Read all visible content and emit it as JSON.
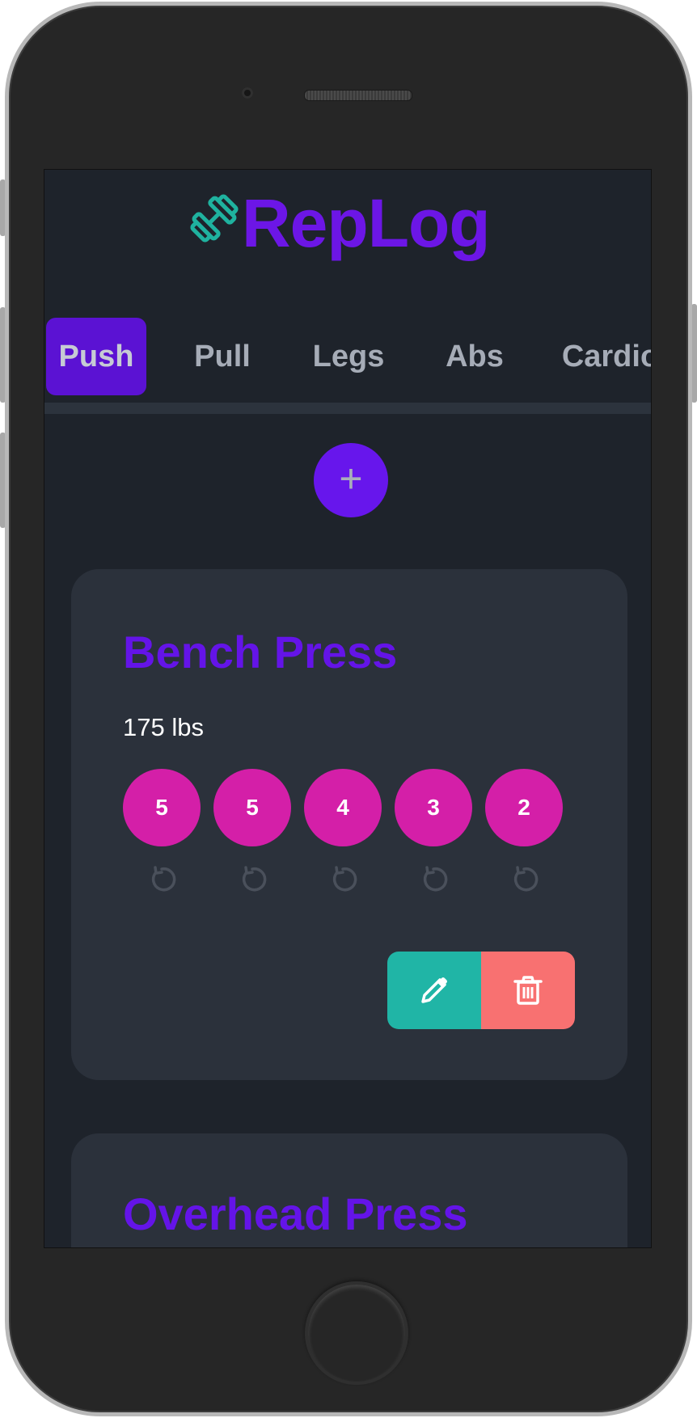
{
  "app": {
    "title": "RepLog",
    "logo_icon": "dumbbell-icon",
    "accent_color": "#6c16e6"
  },
  "tabs": [
    {
      "label": "Push",
      "active": true
    },
    {
      "label": "Pull",
      "active": false
    },
    {
      "label": "Legs",
      "active": false
    },
    {
      "label": "Abs",
      "active": false
    },
    {
      "label": "Cardio",
      "active": false
    }
  ],
  "add_button": {
    "label": "+"
  },
  "exercises": [
    {
      "name": "Bench Press",
      "weight": "175 lbs",
      "sets": [
        "5",
        "5",
        "4",
        "3",
        "2"
      ],
      "set_color": "#d41fa8",
      "undo_icon": "undo-icon",
      "edit_icon": "pencil-icon",
      "delete_icon": "trash-icon",
      "edit_color": "#20b5a6",
      "delete_color": "#f87171"
    },
    {
      "name": "Overhead Press"
    }
  ]
}
